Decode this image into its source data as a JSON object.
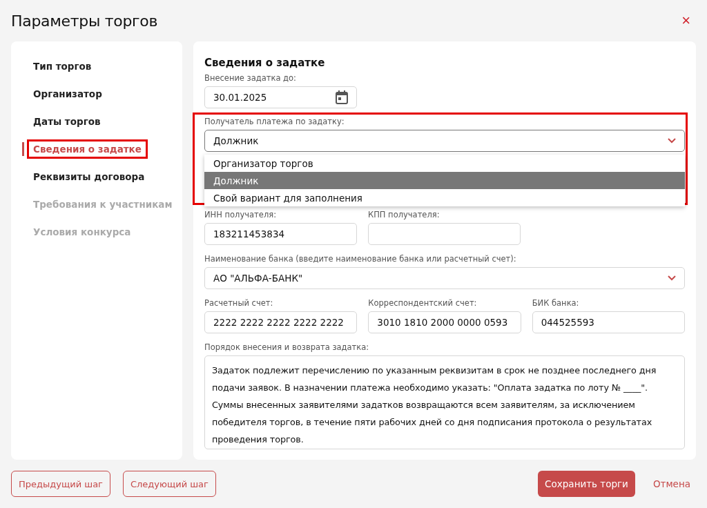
{
  "window": {
    "title": "Параметры торгов",
    "close": "×"
  },
  "sidebar": {
    "items": [
      {
        "label": "Тип торгов",
        "selected": false,
        "disabled": false,
        "highlighted": false
      },
      {
        "label": "Организатор",
        "selected": false,
        "disabled": false,
        "highlighted": false
      },
      {
        "label": "Даты торгов",
        "selected": false,
        "disabled": false,
        "highlighted": false
      },
      {
        "label": "Сведения о задатке",
        "selected": true,
        "disabled": false,
        "highlighted": true
      },
      {
        "label": "Реквизиты договора",
        "selected": false,
        "disabled": false,
        "highlighted": false
      },
      {
        "label": "Требования к участникам",
        "selected": false,
        "disabled": true,
        "highlighted": false
      },
      {
        "label": "Условия конкурса",
        "selected": false,
        "disabled": true,
        "highlighted": false
      }
    ]
  },
  "form": {
    "heading": "Сведения о задатке",
    "deposit_date": {
      "label": "Внесение задатка до:",
      "value": "30.01.2025"
    },
    "recipient": {
      "label": "Получатель платежа по задатку:",
      "value": "Должник",
      "expanded": true,
      "highlighted": true,
      "options": [
        {
          "label": "Организатор торгов",
          "selected": false
        },
        {
          "label": "Должник",
          "selected": true
        },
        {
          "label": "Свой вариант для заполнения",
          "selected": false
        }
      ]
    },
    "inn": {
      "label": "ИНН получателя:",
      "value": "183211453834"
    },
    "kpp": {
      "label": "КПП получателя:"
    },
    "bank": {
      "label": "Наименование банка (введите наименование банка или расчетный счет):",
      "value": "АО \"АЛЬФА-БАНК\""
    },
    "account": {
      "label": "Расчетный счет:",
      "value": "2222 2222 2222 2222 2222"
    },
    "corr_account": {
      "label": "Корреспондентский счет:",
      "value": "3010 1810 2000 0000 0593"
    },
    "bik": {
      "label": "БИК банка:",
      "value": "044525593"
    },
    "procedure": {
      "label": "Порядок внесения и возврата задатка:",
      "value": "Задаток подлежит перечислению по указанным реквизитам в срок не позднее последнего дня подачи заявок. В назначении платежа необходимо указать: \"Оплата задатка по лоту № ____\". Суммы внесенных заявителями задатков возвращаются всем заявителям, за исключением победителя торгов, в течение пяти рабочих дней со дня подписания протокола о результатах проведения торгов."
    }
  },
  "footer": {
    "prev": "Предыдущий шаг",
    "next": "Следующий шаг",
    "save": "Сохранить торги",
    "cancel": "Отмена"
  }
}
